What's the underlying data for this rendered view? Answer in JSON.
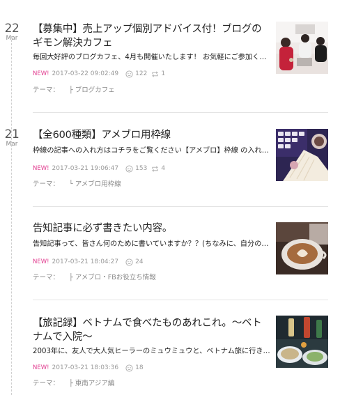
{
  "entries": [
    {
      "day": "22",
      "month": "Mar",
      "title": "【募集中】売上アップ個別アドバイス付！ブログのギモン解決カフェ",
      "excerpt": "毎回大好評のブログカフェ、4月も開催いたします！ お気軽にご参加ください...",
      "new_label": "NEW!",
      "time": "2017-03-22 09:02:49",
      "likes": "122",
      "reblogs": "1",
      "theme_label": "テーマ：",
      "theme": "ブログカフェ",
      "thumb_alt": "cafe-group-photo"
    },
    {
      "day": "21",
      "month": "Mar",
      "title": "【全600種類】アメブロ用枠線",
      "excerpt": "枠線の記事への入れ方はコチラをご覧ください【アメブロ】枠線 の入れ方　解...",
      "new_label": "NEW!",
      "time": "2017-03-21 19:06:47",
      "likes": "153",
      "reblogs": "4",
      "theme_label": "テーマ：",
      "theme": "アメブロ用枠線",
      "thumb_alt": "keyboard-coffee-photo"
    },
    {
      "day": "",
      "month": "",
      "title": "告知記事に必ず書きたい内容。",
      "excerpt": "告知記事って、皆さん何のために書いていますか？？(ちなみに、自分のサ...",
      "new_label": "NEW!",
      "time": "2017-03-21 18:04:27",
      "likes": "24",
      "reblogs": "",
      "theme_label": "テーマ：",
      "theme": "アメブロ・FBお役立ち情報",
      "thumb_alt": "latte-photo"
    },
    {
      "day": "",
      "month": "",
      "title": "【旅記録】ベトナムで食べたものあれこれ。～ベトナムで入院～",
      "excerpt": "2003年に、友人で大人気ヒーラーのミュウミュウと、ベトナム旅に行きまし...",
      "new_label": "NEW!",
      "time": "2017-03-21 18:03:36",
      "likes": "18",
      "reblogs": "",
      "theme_label": "テーマ：",
      "theme": "東南アジア編",
      "thumb_alt": "vietnam-food-photo"
    }
  ]
}
